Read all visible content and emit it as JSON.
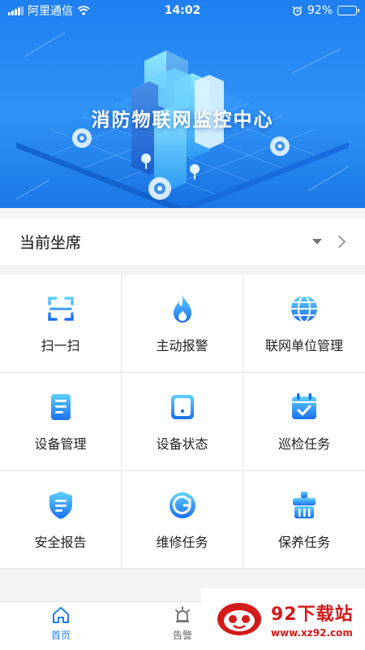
{
  "status_bar": {
    "carrier": "阿里通信",
    "time": "14:02",
    "battery_percent": "92%",
    "battery_level": 0.92
  },
  "hero": {
    "title": "消防物联网监控中心"
  },
  "seat": {
    "label": "当前坐席"
  },
  "grid": {
    "items": [
      {
        "label": "扫一扫",
        "icon": "scan-icon"
      },
      {
        "label": "主动报警",
        "icon": "flame-icon"
      },
      {
        "label": "联网单位管理",
        "icon": "globe-icon"
      },
      {
        "label": "设备管理",
        "icon": "document-icon"
      },
      {
        "label": "设备状态",
        "icon": "device-status-icon"
      },
      {
        "label": "巡检任务",
        "icon": "calendar-check-icon"
      },
      {
        "label": "安全报告",
        "icon": "shield-icon"
      },
      {
        "label": "维修任务",
        "icon": "repair-icon"
      },
      {
        "label": "保养任务",
        "icon": "maintenance-icon"
      }
    ]
  },
  "tabbar": {
    "home": "首页",
    "alarm": "告警"
  },
  "watermark": {
    "title": "92下载站",
    "url": "www.xz92.com"
  },
  "colors": {
    "primary": "#1f7ff0",
    "icon_gradient_top": "#5fd0ff",
    "icon_gradient_bottom": "#1b6ff0"
  }
}
